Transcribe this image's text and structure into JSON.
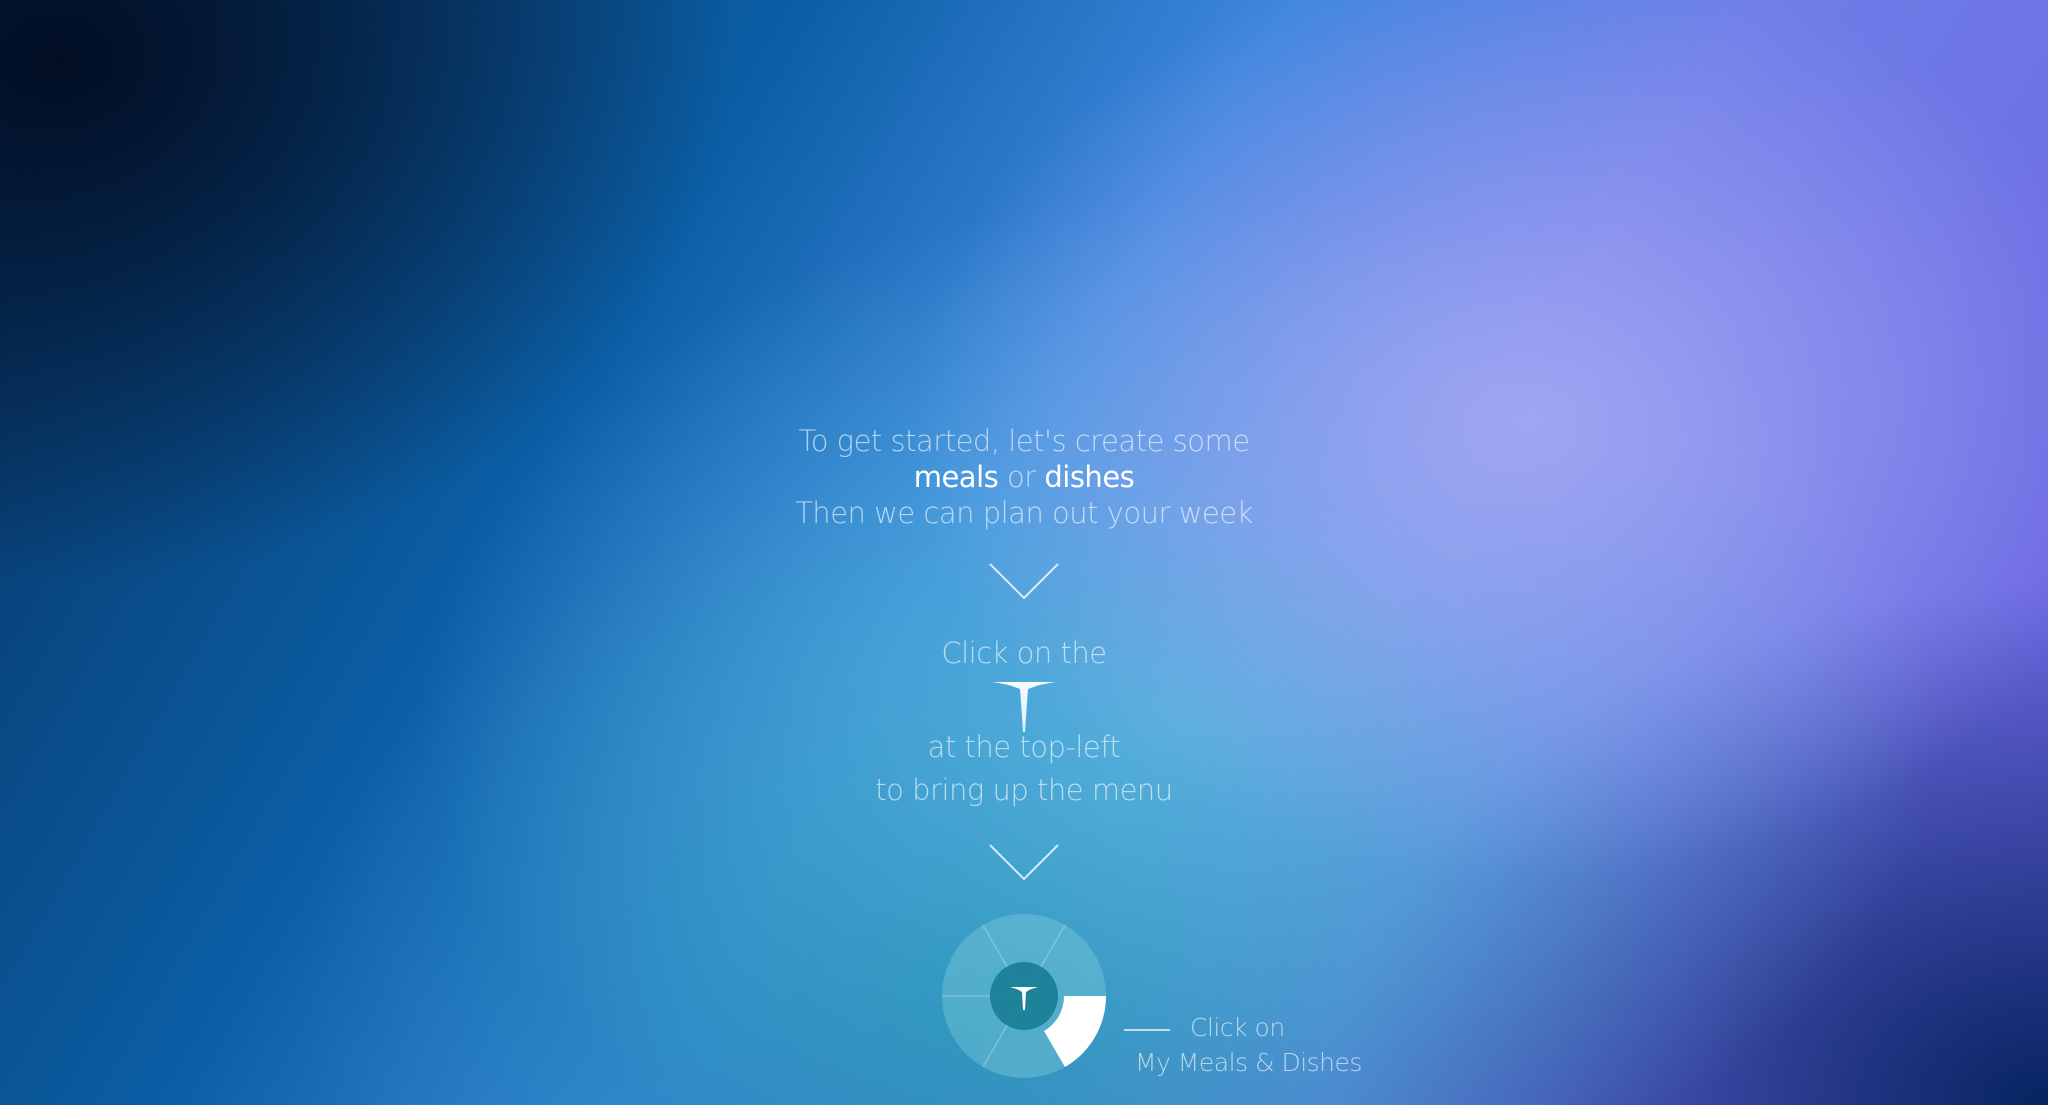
{
  "intro": {
    "line1": "To get started, let's create some",
    "meals": "meals",
    "or": "or",
    "dishes": "dishes",
    "line3": "Then we can plan out your week"
  },
  "step2": {
    "click_on_the": "Click on the",
    "top_left": "at the top-left",
    "bring_menu": "to bring up the menu"
  },
  "menu_hint": {
    "click_on": "Click on",
    "target_label": "My Meals & Dishes"
  },
  "icons": {
    "arrow_down": "chevron-down-icon",
    "logo": "t-logo-icon",
    "menu_wheel": "radial-menu-icon"
  },
  "colors": {
    "accent": "#ffffff",
    "wheel_segment": "#4aa3b8",
    "wheel_center": "#1f7f98",
    "selected_segment": "#ffffff"
  }
}
